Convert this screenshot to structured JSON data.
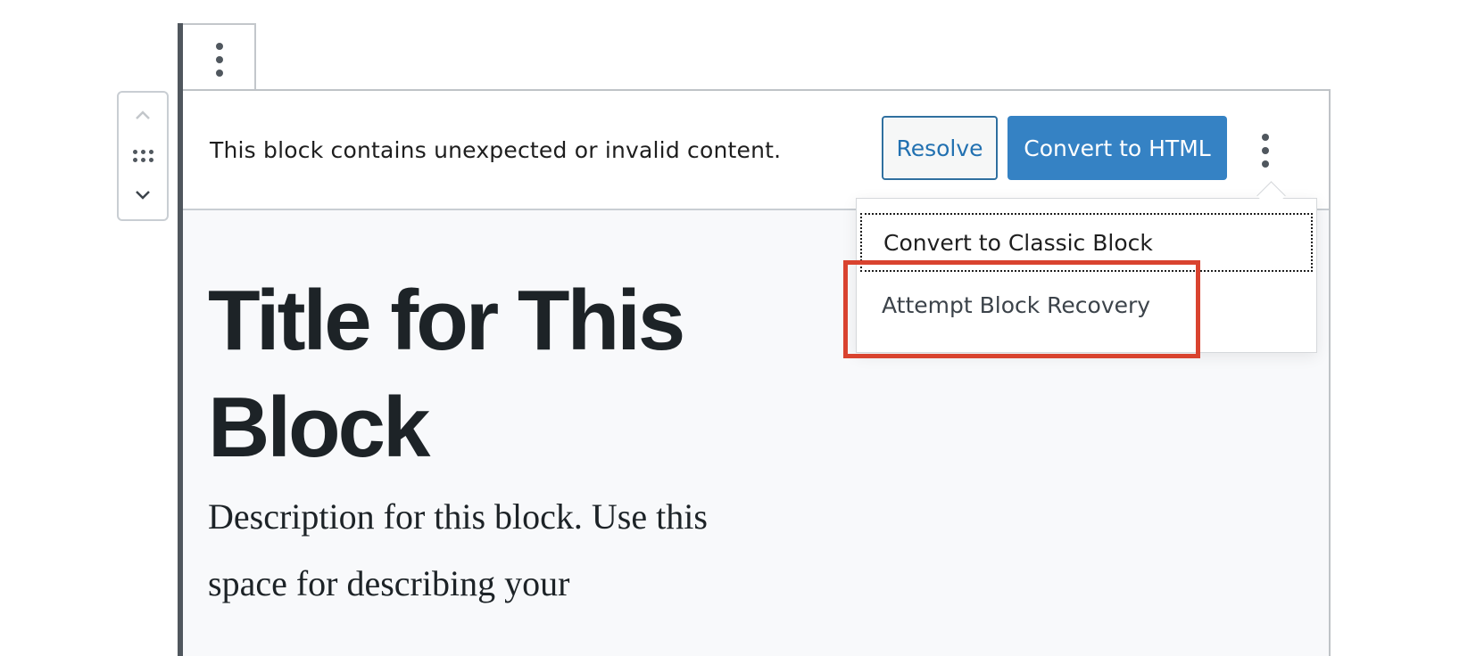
{
  "block_toolbar": {
    "more_options_icon": "vertical-ellipsis-icon"
  },
  "mover": {
    "up_icon": "chevron-up-icon",
    "drag_icon": "drag-handle-icon",
    "down_icon": "chevron-down-icon"
  },
  "warning": {
    "message": "This block contains unexpected or invalid content.",
    "resolve_label": "Resolve",
    "convert_label": "Convert to HTML",
    "more_icon": "vertical-ellipsis-icon"
  },
  "dropdown": {
    "items": [
      {
        "label": "Convert to Classic Block"
      },
      {
        "label": "Attempt Block Recovery"
      }
    ]
  },
  "content": {
    "title": "Title for This Block",
    "description": "Description for this block. Use this space for describing your"
  },
  "colors": {
    "primary_button": "#3582c4",
    "highlight": "#d9432f",
    "accent_bar": "#50575e"
  }
}
